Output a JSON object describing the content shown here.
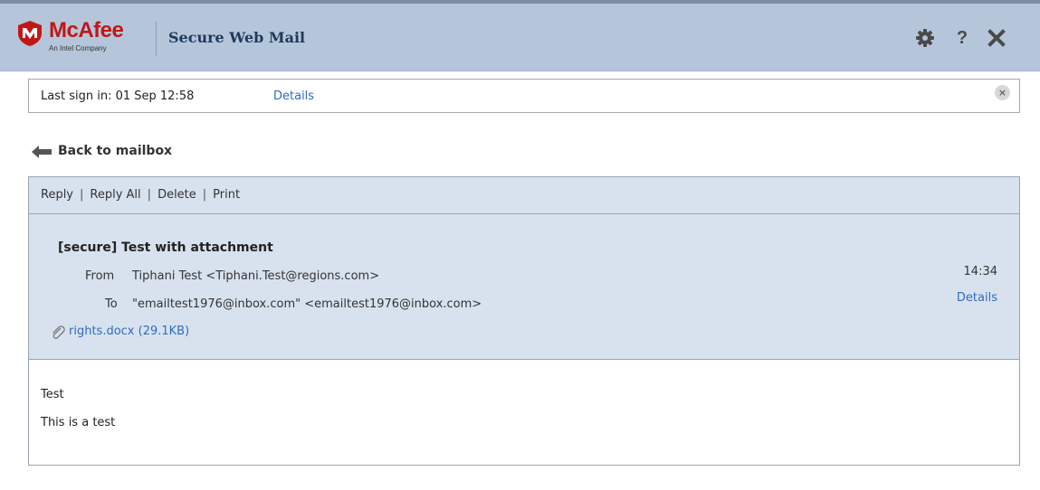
{
  "header": {
    "brand": "McAfee",
    "brand_sub": "An Intel Company",
    "app_title": "Secure Web Mail",
    "help_label": "?",
    "icons": [
      "gear-icon",
      "help-icon",
      "close-icon"
    ],
    "colors": {
      "header_bg": "#b5c6da",
      "brand_red": "#c01818",
      "link_blue": "#2f6cc4"
    }
  },
  "signin": {
    "text": "Last sign in: 01 Sep 12:58",
    "details_link": "Details",
    "close_glyph": "×"
  },
  "nav": {
    "back_label": "Back to mailbox"
  },
  "toolbar": {
    "items": [
      "Reply",
      "Reply All",
      "Delete",
      "Print"
    ],
    "separator": "|"
  },
  "message": {
    "subject": "[secure] Test with attachment",
    "from_label": "From",
    "from_value": "Tiphani Test <Tiphani.Test@regions.com>",
    "to_label": "To",
    "to_value": "\"emailtest1976@inbox.com\" <emailtest1976@inbox.com>",
    "time": "14:34",
    "details_link": "Details",
    "attachment": "rights.docx (29.1KB)",
    "body": [
      "Test",
      "This is a test"
    ]
  }
}
